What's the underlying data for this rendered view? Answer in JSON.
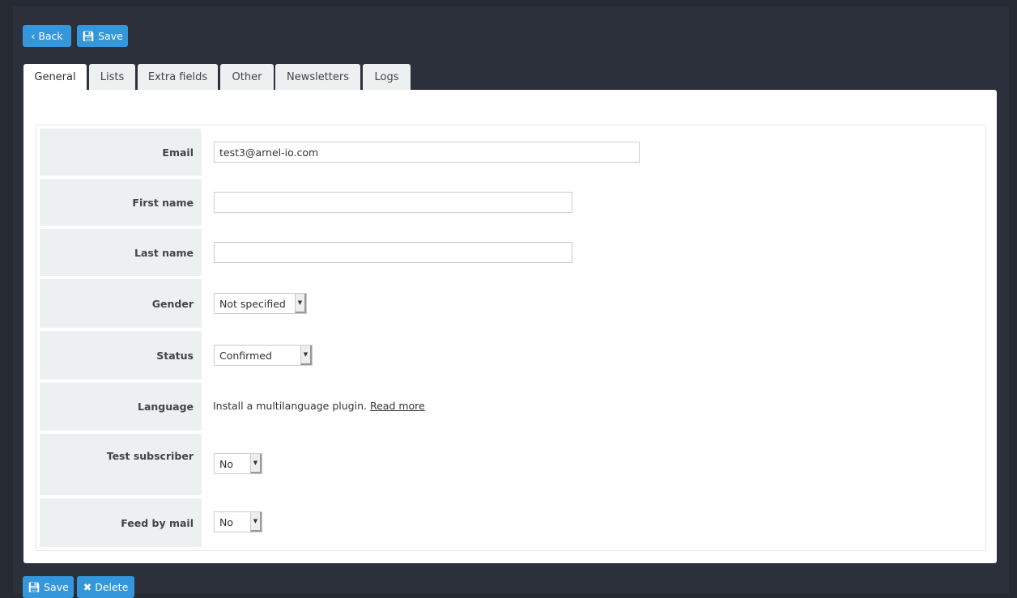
{
  "toolbar": {
    "back": "Back",
    "save": "Save"
  },
  "tabs": [
    "General",
    "Lists",
    "Extra fields",
    "Other",
    "Newsletters",
    "Logs"
  ],
  "form": {
    "email": {
      "label": "Email",
      "value": "test3@arnel-io.com"
    },
    "first_name": {
      "label": "First name",
      "value": ""
    },
    "last_name": {
      "label": "Last name",
      "value": ""
    },
    "gender": {
      "label": "Gender",
      "value": "Not specified"
    },
    "status": {
      "label": "Status",
      "value": "Confirmed"
    },
    "language": {
      "label": "Language",
      "text": "Install a multilanguage plugin.",
      "link": "Read more"
    },
    "test_subscriber": {
      "label": "Test subscriber",
      "value": "No"
    },
    "feed_by_mail": {
      "label": "Feed by mail",
      "value": "No"
    }
  },
  "footer": {
    "save": "Save",
    "delete": "Delete"
  },
  "colors": {
    "accent": "#3497db",
    "background": "#2b303b"
  }
}
